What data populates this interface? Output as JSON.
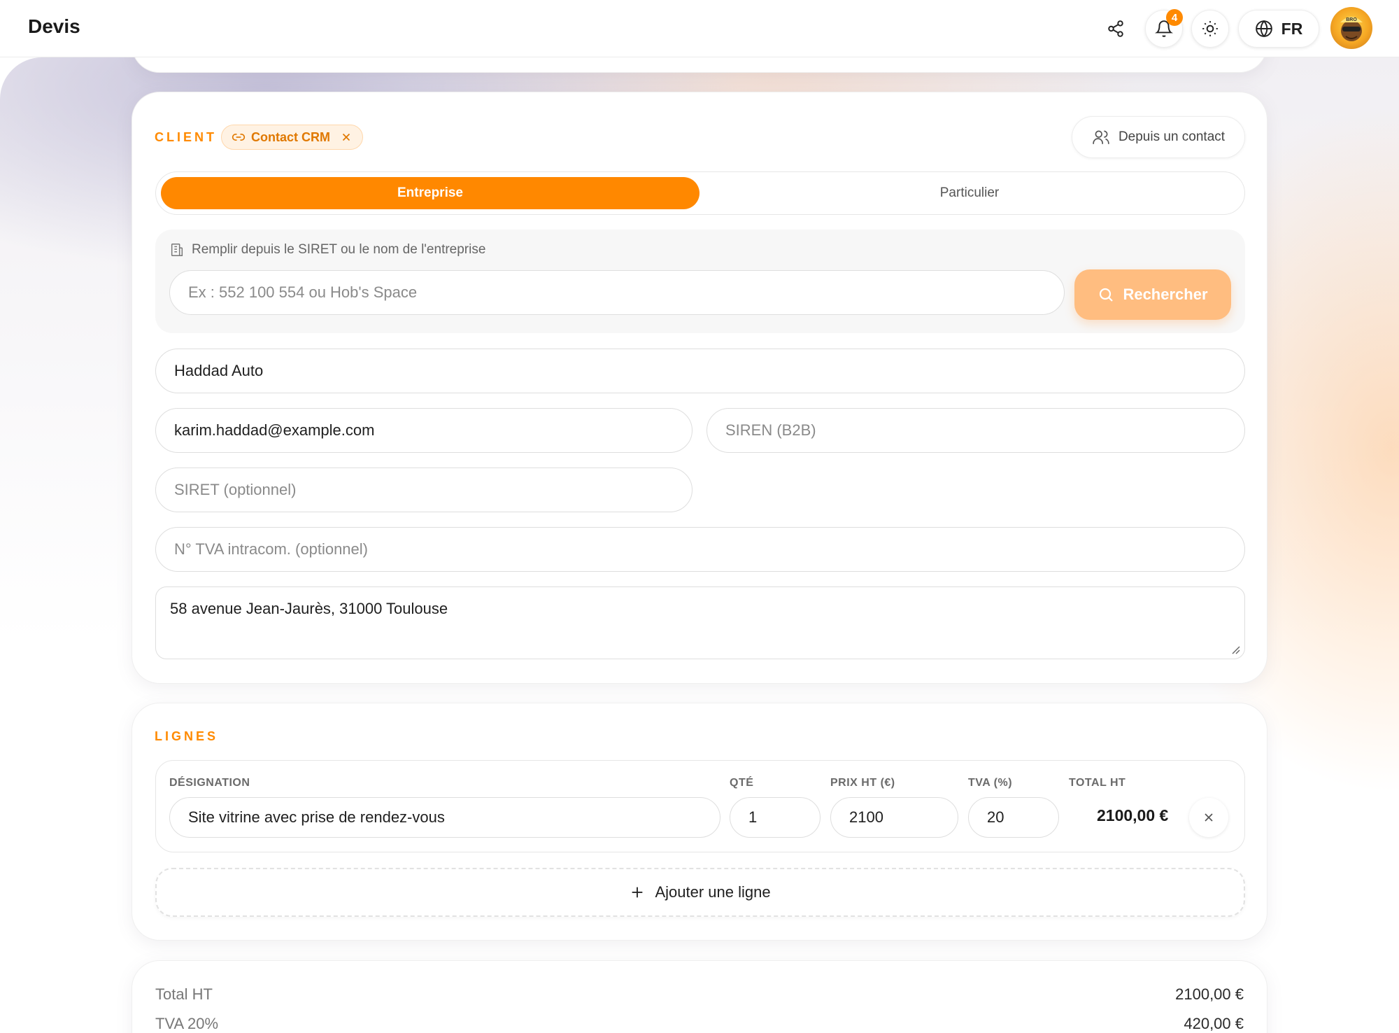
{
  "header": {
    "title": "Devis",
    "notification_count": "4",
    "language": "FR",
    "avatar_text": "BRO"
  },
  "client": {
    "section_label": "CLIENT",
    "crm_chip_label": "Contact CRM",
    "from_contact_button": "Depuis un contact",
    "tabs": [
      {
        "label": "Entreprise",
        "active": true
      },
      {
        "label": "Particulier",
        "active": false
      }
    ],
    "siret_hint": "Remplir depuis le SIRET ou le nom de l'entreprise",
    "siret_search_placeholder": "Ex : 552 100 554 ou Hob's Space",
    "search_button": "Rechercher",
    "company_name_value": "Haddad Auto",
    "email_value": "karim.haddad@example.com",
    "siren_placeholder": "SIREN (B2B)",
    "siret_placeholder": "SIRET (optionnel)",
    "vat_placeholder": "N° TVA intracom. (optionnel)",
    "address_value": "58 avenue Jean-Jaurès, 31000 Toulouse"
  },
  "lines": {
    "section_label": "LIGNES",
    "columns": {
      "designation": "DÉSIGNATION",
      "qty": "QTÉ",
      "price": "PRIX HT (€)",
      "vat": "TVA (%)",
      "total": "TOTAL HT"
    },
    "items": [
      {
        "designation": "Site vitrine avec prise de rendez-vous",
        "qty": "1",
        "price": "2100",
        "vat": "20",
        "total": "2100,00 €"
      }
    ],
    "add_line_button": "Ajouter une ligne"
  },
  "totals": {
    "total_ht_label": "Total HT",
    "total_ht_value": "2100,00 €",
    "vat_label": "TVA 20%",
    "vat_value": "420,00 €"
  },
  "colors": {
    "accent": "#ff8800",
    "accent_light": "#ffbd80"
  }
}
